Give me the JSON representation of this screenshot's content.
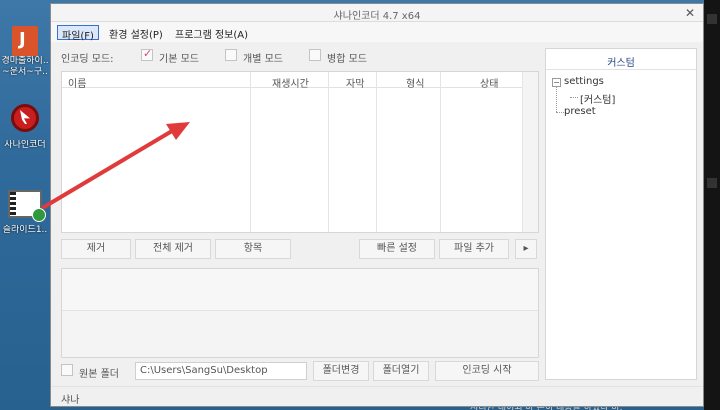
{
  "desktop": {
    "icons": [
      {
        "name": "doc-icon",
        "label1": "경마출하이..",
        "label2": "~운서~구.."
      },
      {
        "name": "sanaencoder-icon",
        "label1": "사나인코더",
        "label2": ""
      },
      {
        "name": "video-file-icon",
        "label1": "슬라이드1..",
        "label2": ""
      }
    ],
    "bottom_text": "시리한 내이되 마 흔히 내용을 하였다 마."
  },
  "window": {
    "title": "샤나인코더 4.7 x64",
    "close_symbol": "✕"
  },
  "menu": {
    "file": "파일(F)",
    "settings": "환경 설정(P)",
    "about": "프로그램 정보(A)"
  },
  "encoding_mode": {
    "label": "인코딩 모드:",
    "basic": "기본 모드",
    "individual": "개별 모드",
    "merge": "병합 모드",
    "basic_checked": true
  },
  "file_list": {
    "columns": [
      "이름",
      "재생시간",
      "자막",
      "형식",
      "상태"
    ]
  },
  "buttons": {
    "remove": "제거",
    "remove_all": "전체 제거",
    "item": "항목",
    "quick_settings": "빠른 설정",
    "add_file": "파일 추가",
    "more": "▸",
    "change_folder": "폴더변경",
    "open_folder": "폴더열기",
    "start_encoding": "인코딩 시작"
  },
  "output": {
    "source_folder_label": "원본 폴더",
    "path": "C:\\Users\\SangSu\\Desktop"
  },
  "right_panel": {
    "title": "커스텀",
    "tree": {
      "settings": "settings",
      "custom": "[커스텀]",
      "preset": "preset"
    }
  },
  "status": {
    "text": "샤나"
  },
  "colors": {
    "arrow": "#e03a3a",
    "accent": "#3a6fd0"
  }
}
